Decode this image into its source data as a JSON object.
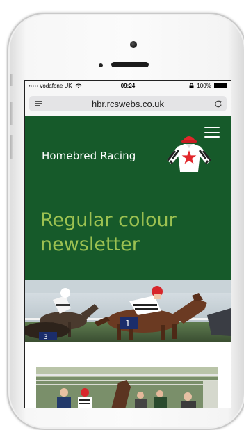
{
  "status_bar": {
    "carrier": "•◦◦◦◦ vodafone UK",
    "time": "09:24",
    "battery": "100%"
  },
  "browser": {
    "url": "hbr.rcswebs.co.uk"
  },
  "site": {
    "brand": "Homebred Racing",
    "heading": "Regular colour newsletter"
  },
  "colors": {
    "header_green": "#165a2a",
    "heading_green": "#9cc151",
    "silks_star": "#e2262b"
  },
  "icons": {
    "wifi": "wifi-icon",
    "lock": "lock-icon",
    "menu": "hamburger-menu-icon",
    "reload": "reload-icon",
    "reader": "reader-list-icon",
    "silks": "racing-silks-logo"
  }
}
